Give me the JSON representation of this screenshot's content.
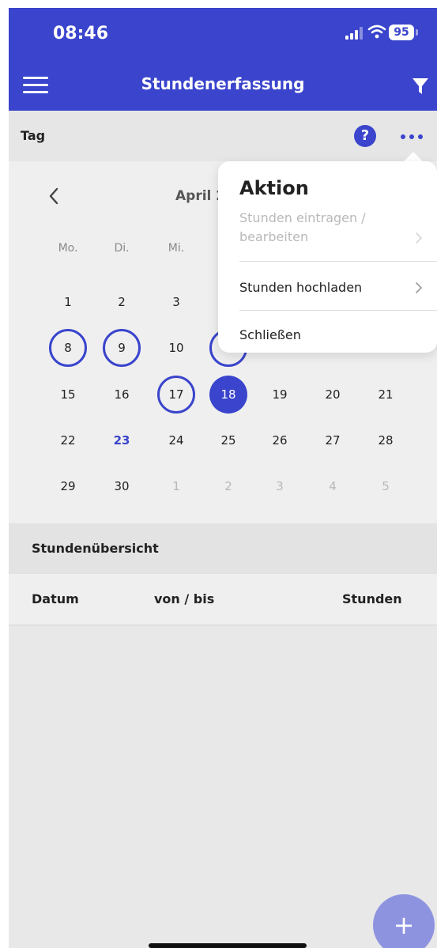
{
  "status": {
    "time": "08:46",
    "battery": "95"
  },
  "header": {
    "title": "Stundenerfassung"
  },
  "tagbar": {
    "label": "Tag",
    "help": "?"
  },
  "calendar": {
    "month_label": "April 2",
    "weekdays": [
      "Mo.",
      "Di.",
      "Mi."
    ],
    "rows": [
      [
        {
          "d": "1"
        },
        {
          "d": "2"
        },
        {
          "d": "3"
        }
      ],
      [
        {
          "d": "8",
          "ring": true
        },
        {
          "d": "9",
          "ring": true
        },
        {
          "d": "10"
        },
        {
          "d": "",
          "ring": true
        }
      ],
      [
        {
          "d": "15"
        },
        {
          "d": "16"
        },
        {
          "d": "17",
          "ring": true
        },
        {
          "d": "18",
          "selected": true
        },
        {
          "d": "19"
        },
        {
          "d": "20"
        },
        {
          "d": "21"
        }
      ],
      [
        {
          "d": "22"
        },
        {
          "d": "23",
          "today": true
        },
        {
          "d": "24"
        },
        {
          "d": "25"
        },
        {
          "d": "26"
        },
        {
          "d": "27"
        },
        {
          "d": "28"
        }
      ],
      [
        {
          "d": "29"
        },
        {
          "d": "30"
        },
        {
          "d": "1",
          "other": true
        },
        {
          "d": "2",
          "other": true
        },
        {
          "d": "3",
          "other": true
        },
        {
          "d": "4",
          "other": true
        },
        {
          "d": "5",
          "other": true
        }
      ]
    ]
  },
  "summary": {
    "title": "Stundenübersicht",
    "columns": {
      "date": "Datum",
      "range": "von / bis",
      "hours": "Stunden"
    }
  },
  "popover": {
    "title": "Aktion",
    "items": [
      {
        "label": "Stunden eintragen / bearbeiten",
        "disabled": true
      },
      {
        "label": "Stunden hochladen"
      },
      {
        "label": "Schließen"
      }
    ]
  },
  "fab": {
    "label": "+"
  },
  "colors": {
    "accent": "#3a44cc",
    "fab": "#8e93e0"
  }
}
